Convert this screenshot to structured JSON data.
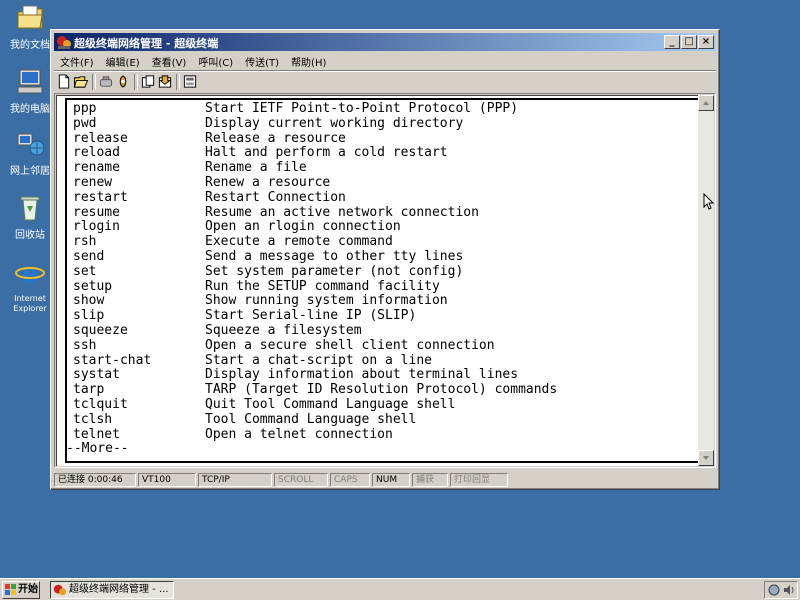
{
  "desktop": {
    "icons": [
      {
        "label": "我的文档",
        "icon": "documents-folder-icon"
      },
      {
        "label": "我的电脑",
        "icon": "my-computer-icon"
      },
      {
        "label": "网上邻居",
        "icon": "network-icon"
      },
      {
        "label": "回收站",
        "icon": "recycle-bin-icon"
      },
      {
        "label": "Internet Explorer",
        "icon": "internet-explorer-icon"
      }
    ]
  },
  "window": {
    "title": "超级终端网络管理 - 超级终端",
    "controls": {
      "minimize": "_",
      "maximize": "□",
      "close": "×"
    },
    "menu": [
      "文件(F)",
      "编辑(E)",
      "查看(V)",
      "呼叫(C)",
      "传送(T)",
      "帮助(H)"
    ],
    "toolbar": [
      "new-icon",
      "open-icon",
      "disconnect-icon",
      "properties-icon",
      "send-icon",
      "receive-icon",
      "settings-icon"
    ]
  },
  "terminal": {
    "lines": [
      {
        "cmd": "ppp",
        "desc": "Start IETF Point-to-Point Protocol (PPP)"
      },
      {
        "cmd": "pwd",
        "desc": "Display current working directory"
      },
      {
        "cmd": "release",
        "desc": "Release a resource"
      },
      {
        "cmd": "reload",
        "desc": "Halt and perform a cold restart"
      },
      {
        "cmd": "rename",
        "desc": "Rename a file"
      },
      {
        "cmd": "renew",
        "desc": "Renew a resource"
      },
      {
        "cmd": "restart",
        "desc": "Restart Connection"
      },
      {
        "cmd": "resume",
        "desc": "Resume an active network connection"
      },
      {
        "cmd": "rlogin",
        "desc": "Open an rlogin connection"
      },
      {
        "cmd": "rsh",
        "desc": "Execute a remote command"
      },
      {
        "cmd": "send",
        "desc": "Send a message to other tty lines"
      },
      {
        "cmd": "set",
        "desc": "Set system parameter (not config)"
      },
      {
        "cmd": "setup",
        "desc": "Run the SETUP command facility"
      },
      {
        "cmd": "show",
        "desc": "Show running system information"
      },
      {
        "cmd": "slip",
        "desc": "Start Serial-line IP (SLIP)"
      },
      {
        "cmd": "squeeze",
        "desc": "Squeeze a filesystem"
      },
      {
        "cmd": "ssh",
        "desc": "Open a secure shell client connection"
      },
      {
        "cmd": "start-chat",
        "desc": "Start a chat-script on a line"
      },
      {
        "cmd": "systat",
        "desc": "Display information about terminal lines"
      },
      {
        "cmd": "tarp",
        "desc": "TARP (Target ID Resolution Protocol) commands"
      },
      {
        "cmd": "tclquit",
        "desc": "Quit Tool Command Language shell"
      },
      {
        "cmd": "tclsh",
        "desc": "Tool Command Language shell"
      },
      {
        "cmd": "telnet",
        "desc": "Open a telnet connection"
      }
    ],
    "more": "--More--"
  },
  "statusbar": {
    "connected": "已连接 0:00:46",
    "emulation": "VT100",
    "protocol": "TCP/IP",
    "scroll": "SCROLL",
    "caps": "CAPS",
    "num": "NUM",
    "capture": "捕获",
    "print_echo": "打印回显"
  },
  "taskbar": {
    "start": "开始",
    "task": "超级终端网络管理 - ..."
  }
}
